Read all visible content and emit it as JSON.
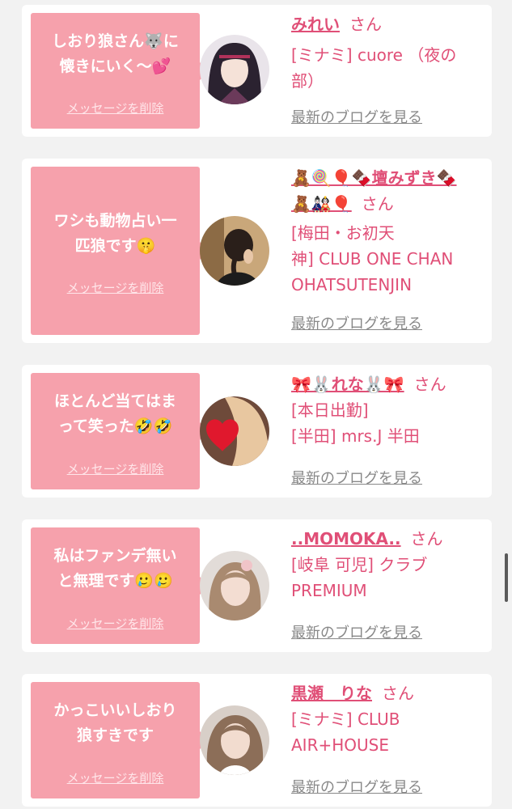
{
  "delete_label": "メッセージを削除",
  "blog_label": "最新のブログを見る",
  "suffix": "さん",
  "colors": {
    "page_bg": "#f2f2f2",
    "bubble": "#f6a1ac",
    "accent": "#e04f77",
    "link_gray": "#888888"
  },
  "entries": [
    {
      "message_lines": [
        "しおり狼さん🐺に",
        "懐きにいく〜💕"
      ],
      "name": "みれい",
      "shop_lines": [
        "[ミナミ] cuore （夜の",
        "部）"
      ]
    },
    {
      "message_lines": [
        "ワシも動物占い一",
        "匹狼です🤫"
      ],
      "name_lines": [
        "🧸🍭🎈🍫壇みずき🍫",
        "🧸🎎🎈"
      ],
      "shop_lines": [
        "[梅田・お初天",
        "神] CLUB ONE CHAN",
        "OHATSUTENJIN"
      ]
    },
    {
      "message_lines": [
        "ほとんど当てはま",
        "って笑った🤣🤣"
      ],
      "name": "🎀🐰れな🐰🎀",
      "shop_lines": [
        "[本日出勤]",
        "[半田] mrs.J 半田"
      ]
    },
    {
      "message_lines": [
        "私はファンデ無い",
        "と無理です🥲🥲"
      ],
      "name": "..MOMOKA..",
      "shop_lines": [
        "[岐阜 可児] クラブ",
        "PREMIUM"
      ]
    },
    {
      "message_lines": [
        "かっこいいしおり",
        "狼すきです"
      ],
      "name": "黒瀬　りな",
      "shop_lines": [
        "[ミナミ] CLUB",
        "AIR+HOUSE"
      ]
    }
  ]
}
